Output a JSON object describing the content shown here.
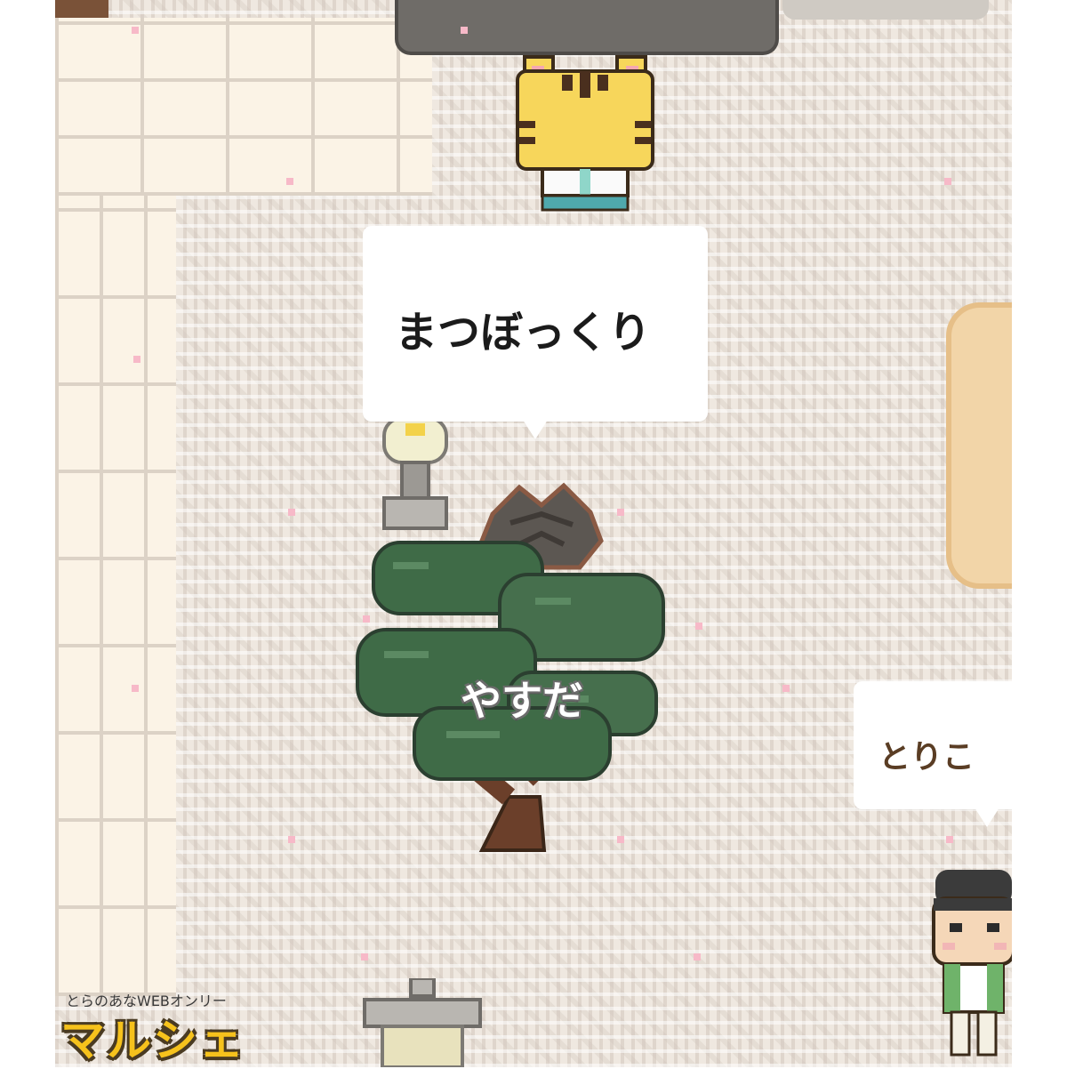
{
  "game": {
    "speech_bubble_main": "まつぼっくり",
    "speech_bubble_right": "とりこ",
    "player_name": "やすだ"
  },
  "logo": {
    "subtitle": "とらのあなWEBオンリー",
    "title": "マルシェ"
  },
  "colors": {
    "floor": "#efe8e0",
    "wall": "#fbf3e6",
    "tree_green": "#3f6b47",
    "tree_trunk": "#6b3f2a",
    "tiger_yellow": "#f7d65b",
    "logo_yellow": "#f6c21c",
    "signboard": "#f2d5a8"
  },
  "sprites": [
    "tiger-character",
    "pine-tree",
    "pinecone-pile",
    "street-lamp",
    "boy-character",
    "signboard"
  ]
}
